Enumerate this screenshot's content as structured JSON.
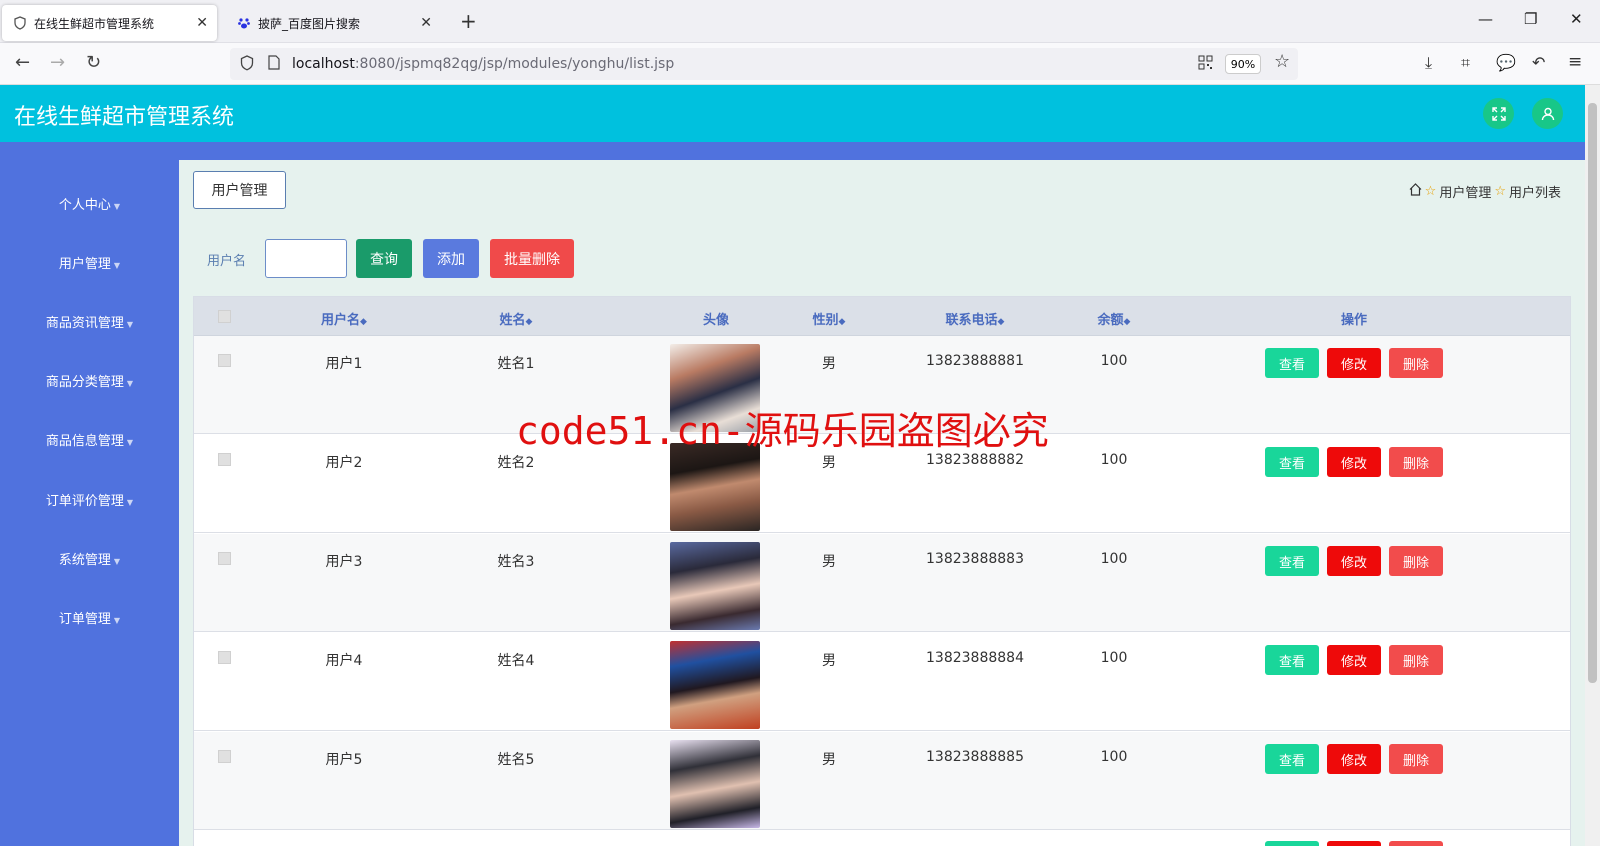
{
  "browser": {
    "tabs": [
      {
        "label": "在线生鲜超市管理系统",
        "active": true
      },
      {
        "label": "披萨_百度图片搜索",
        "active": false
      }
    ],
    "url_host": "localhost",
    "url_path": ":8080/jspmq82qg/jsp/modules/yonghu/list.jsp",
    "zoom": "90%"
  },
  "app": {
    "title": "在线生鲜超市管理系统",
    "colors": {
      "header": "#00c1de",
      "sidebar": "#5072de",
      "main_bg": "#e6f2ee"
    }
  },
  "sidebar": {
    "items": [
      {
        "label": "个人中心"
      },
      {
        "label": "用户管理"
      },
      {
        "label": "商品资讯管理"
      },
      {
        "label": "商品分类管理"
      },
      {
        "label": "商品信息管理"
      },
      {
        "label": "订单评价管理"
      },
      {
        "label": "系统管理"
      },
      {
        "label": "订单管理"
      }
    ]
  },
  "page": {
    "section_title": "用户管理",
    "breadcrumbs": [
      "用户管理",
      "用户列表"
    ]
  },
  "search": {
    "label": "用户名",
    "value": "",
    "query_button": "查询",
    "add_button": "添加",
    "batch_delete_button": "批量删除"
  },
  "table": {
    "headers": {
      "username": "用户名",
      "name": "姓名",
      "avatar": "头像",
      "gender": "性别",
      "phone": "联系电话",
      "balance": "余额",
      "actions": "操作"
    },
    "rows": [
      {
        "username": "用户1",
        "name": "姓名1",
        "gender": "男",
        "phone": "13823888881",
        "balance": "100"
      },
      {
        "username": "用户2",
        "name": "姓名2",
        "gender": "男",
        "phone": "13823888882",
        "balance": "100"
      },
      {
        "username": "用户3",
        "name": "姓名3",
        "gender": "男",
        "phone": "13823888883",
        "balance": "100"
      },
      {
        "username": "用户4",
        "name": "姓名4",
        "gender": "男",
        "phone": "13823888884",
        "balance": "100"
      },
      {
        "username": "用户5",
        "name": "姓名5",
        "gender": "男",
        "phone": "13823888885",
        "balance": "100"
      }
    ],
    "action_labels": {
      "view": "查看",
      "edit": "修改",
      "delete": "删除"
    }
  },
  "watermark": "code51.cn-源码乐园盗图必究"
}
